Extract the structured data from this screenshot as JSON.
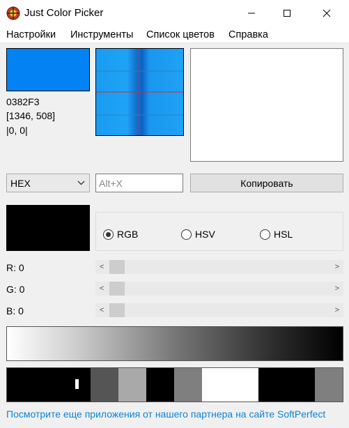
{
  "window": {
    "title": "Just Color Picker",
    "minimize_glyph": "─",
    "maximize_glyph": "☐",
    "close_glyph": "✕"
  },
  "menu": [
    "Настройки",
    "Инструменты",
    "Список цветов",
    "Справка"
  ],
  "current_color": {
    "hex": "#0382F3",
    "code": "0382F3",
    "position": "[1346, 508]",
    "offset": "|0, 0|"
  },
  "format_select": {
    "value": "HEX"
  },
  "hotkey_input": {
    "placeholder": "Alt+X",
    "value": ""
  },
  "copy_button": {
    "label": "Копировать"
  },
  "color_models": {
    "options": [
      "RGB",
      "HSV",
      "HSL"
    ],
    "selected": "RGB"
  },
  "channels": [
    {
      "label": "R: 0",
      "value": 0
    },
    {
      "label": "G: 0",
      "value": 0
    },
    {
      "label": "B: 0",
      "value": 0
    }
  ],
  "palette_colors": [
    "#000000",
    "#000000",
    "#000000",
    "#555555",
    "#a9a9a9",
    "#000000",
    "#7f7f7f",
    "#ffffff",
    "#ffffff",
    "#000000",
    "#000000",
    "#7f7f7f"
  ],
  "footer": {
    "link": "Посмотрите еще приложения от нашего партнера на сайте SoftPerfect"
  },
  "icons": [
    "app-crosshair-icon",
    "minimize-icon",
    "maximize-icon",
    "close-icon",
    "chevron-down-icon",
    "scroll-left-arrow-icon",
    "scroll-right-arrow-icon"
  ]
}
